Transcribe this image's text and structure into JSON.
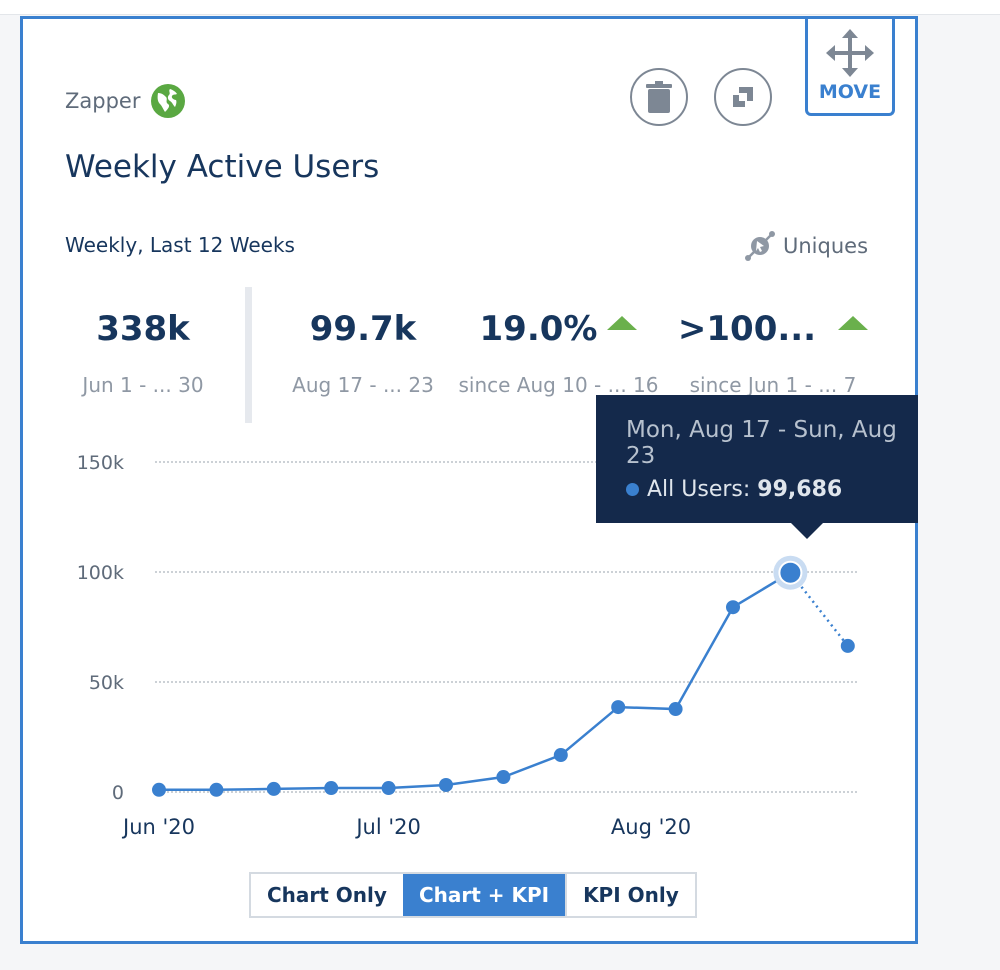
{
  "card": {
    "source": "Zapper",
    "title": "Weekly Active Users",
    "subtitle": "Weekly, Last 12 Weeks",
    "metric_type": "Uniques",
    "move_label": "MOVE",
    "icons": [
      "globe-icon",
      "trash-icon",
      "expand-icon",
      "move-icon",
      "uniques-icon"
    ]
  },
  "kpis": [
    {
      "value": "338k",
      "label": "Jun 1 - ...  30"
    },
    {
      "value": "99.7k",
      "label": "Aug 17 - ...  23"
    },
    {
      "value": "19.0%",
      "label": "since Aug 10 - ... 16",
      "trend": "up"
    },
    {
      "value": ">100...",
      "label": "since Jun 1 - ... 7",
      "trend": "up"
    }
  ],
  "tooltip": {
    "date": "Mon, Aug 17 - Sun, Aug 23",
    "series": "All Users:",
    "value": "99,686"
  },
  "view_toggle": {
    "options": [
      "Chart Only",
      "Chart + KPI",
      "KPI Only"
    ],
    "selected": "Chart + KPI"
  },
  "colors": {
    "accent": "#3a80cf",
    "up": "#6ab04c",
    "navy": "#17365d"
  },
  "chart_data": {
    "type": "line",
    "x": [
      "Jun 1",
      "Jun 8",
      "Jun 15",
      "Jun 22",
      "Jun 29",
      "Jul 6",
      "Jul 13",
      "Jul 20",
      "Jul 27",
      "Aug 3",
      "Aug 10",
      "Aug 17",
      "Aug 24"
    ],
    "series": [
      {
        "name": "All Users",
        "values": [
          1000,
          1000,
          1400,
          1800,
          1800,
          3200,
          6800,
          16800,
          38600,
          37700,
          84000,
          99686,
          66400
        ],
        "last_point_incomplete": true
      }
    ],
    "xticks": [
      {
        "label": "Jun '20",
        "at": "Jun 1"
      },
      {
        "label": "Jul '20",
        "at": "Jun 29"
      },
      {
        "label": "Aug '20",
        "at": "Jul 31"
      }
    ],
    "yticks": [
      {
        "label": "0",
        "value": 0
      },
      {
        "label": "50k",
        "value": 50000
      },
      {
        "label": "100k",
        "value": 100000
      },
      {
        "label": "150k",
        "value": 150000
      }
    ],
    "ylim": [
      0,
      150000
    ],
    "grid": true,
    "highlighted": "Aug 17"
  }
}
